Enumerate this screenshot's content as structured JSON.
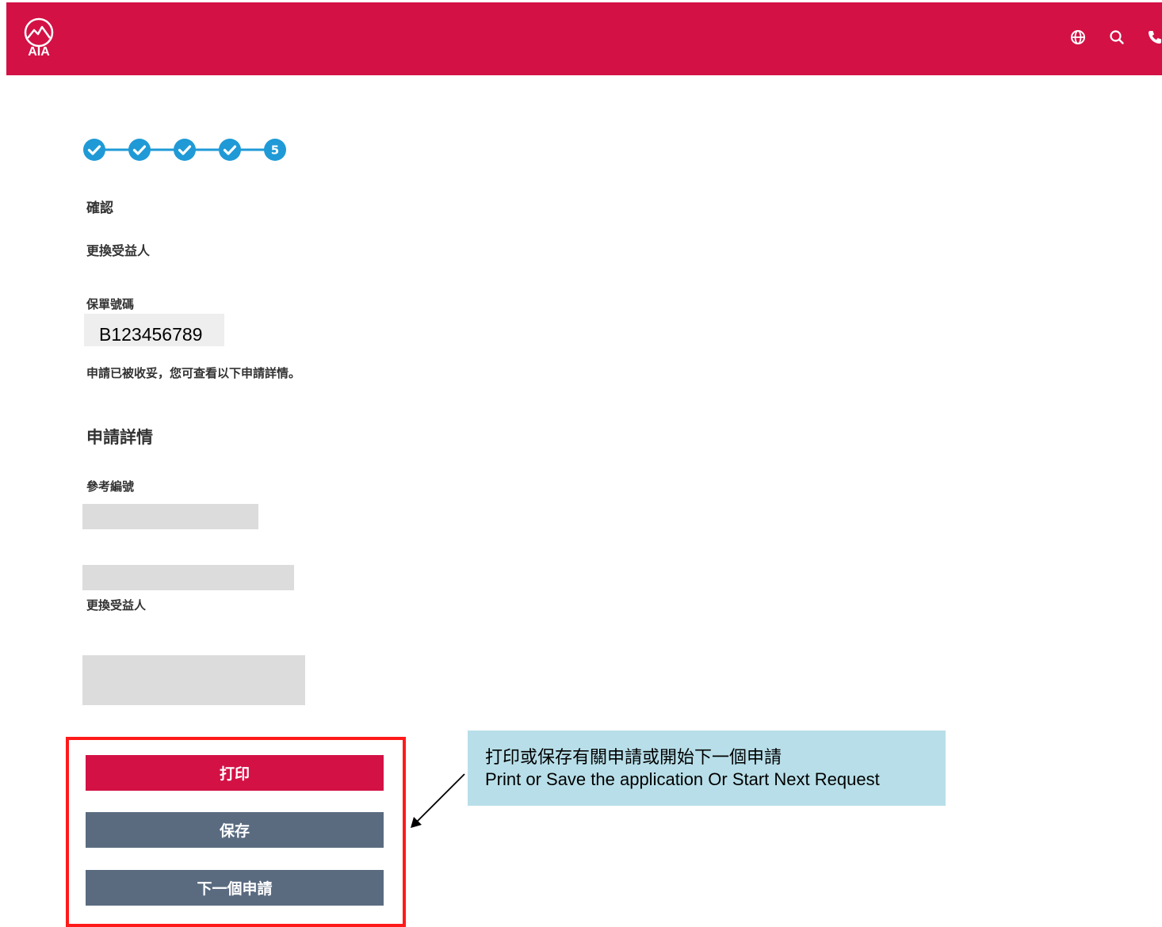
{
  "header": {
    "logo_text": "AIA",
    "brand_color": "#d31145",
    "icons": [
      "globe-icon",
      "search-icon",
      "phone-icon"
    ]
  },
  "stepper": {
    "total_steps": 5,
    "current_step": 5,
    "current_step_label": "5",
    "completed_steps": 4,
    "accent_color": "#1f9ad6"
  },
  "page": {
    "title": "確認",
    "subtitle": "更換受益人"
  },
  "policy": {
    "label": "保單號碼",
    "number": "B123456789"
  },
  "message": "申請已被收妥，您可查看以下申請詳情。",
  "details": {
    "heading": "申請詳情",
    "reference_label": "參考編號",
    "request_type_label": "更換受益人"
  },
  "buttons": {
    "print": "打印",
    "save": "保存",
    "next_request": "下一個申請"
  },
  "callout": {
    "line1": "打印或保存有關申請或開始下一個申請",
    "line2": "Print or Save the application Or Start Next Request"
  }
}
